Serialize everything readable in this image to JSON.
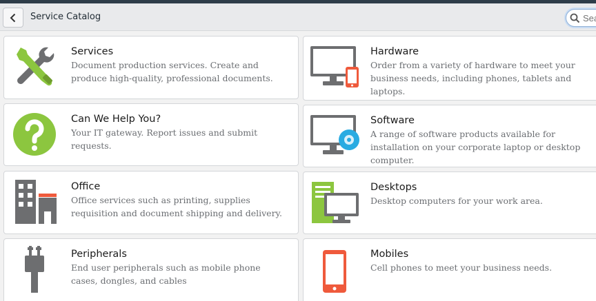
{
  "header": {
    "title": "Service Catalog",
    "search_placeholder": "Search"
  },
  "categories": [
    {
      "title": "Services",
      "description": "Document production services. Create and produce high-quality, professional documents.",
      "icon": "tools-icon"
    },
    {
      "title": "Hardware",
      "description": "Order from a variety of hardware to meet your business needs, including phones, tablets and laptops.",
      "icon": "monitor-phone-icon"
    },
    {
      "title": "Can We Help You?",
      "description": "Your IT gateway. Report issues and submit requests.",
      "icon": "question-icon"
    },
    {
      "title": "Software",
      "description": "A range of software products available for installation on your corporate laptop or desktop computer.",
      "icon": "monitor-disc-icon"
    },
    {
      "title": "Office",
      "description": "Office services such as printing, supplies requisition and document shipping and delivery.",
      "icon": "building-icon"
    },
    {
      "title": "Desktops",
      "description": "Desktop computers for your work area.",
      "icon": "desktop-tower-icon"
    },
    {
      "title": "Peripherals",
      "description": "End user peripherals such as mobile phone cases, dongles, and cables",
      "icon": "plug-icon"
    },
    {
      "title": "Mobiles",
      "description": "Cell phones to meet your business needs.",
      "icon": "mobile-phone-icon"
    }
  ],
  "colors": {
    "green": "#8cc63f",
    "gray": "#6d6e70",
    "orange": "#ef5a3c",
    "blue": "#29abe2"
  }
}
